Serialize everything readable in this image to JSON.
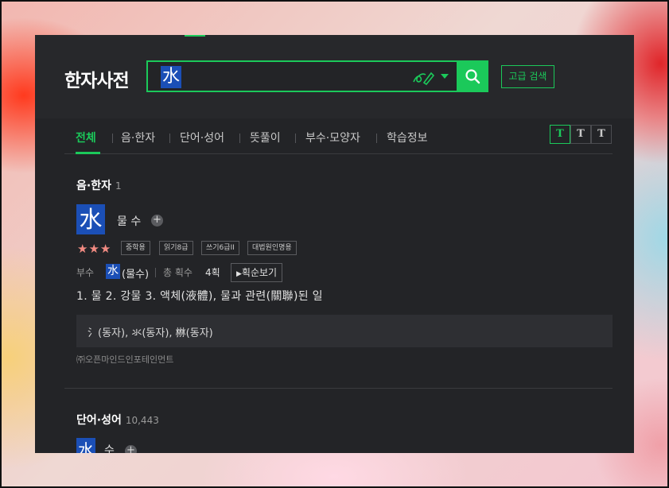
{
  "header": {
    "logo": "한자사전",
    "search_value": "水",
    "advanced_search_label": "고급 검색"
  },
  "tabs": [
    {
      "label": "전체",
      "active": true
    },
    {
      "label": "음·한자"
    },
    {
      "label": "단어·성어"
    },
    {
      "label": "뜻풀이"
    },
    {
      "label": "부수·모양자"
    },
    {
      "label": "학습정보"
    }
  ],
  "font_size_buttons": [
    "T",
    "T",
    "T"
  ],
  "sound_section": {
    "title": "음·한자",
    "count": "1",
    "hanja": "水",
    "meaning": "물 수",
    "stars": "★★★",
    "badges": [
      "중학용",
      "읽기8급",
      "쓰기6급II",
      "대법원인명용"
    ],
    "radical_label": "부수",
    "radical_hanja": "水",
    "radical_name": "(물수)",
    "stroke_label": "총 획수",
    "stroke_count": "4획",
    "stroke_button": "획순보기",
    "definitions": "1. 물  2. 강물  3. 액체(液體), 물과 관련(關聯)된 일",
    "variants": "氵(동자), 氺(동자), 㴇(동자)",
    "publisher": "㈜오픈마인드인포테인먼트"
  },
  "word_section": {
    "title": "단어·성어",
    "count": "10,443",
    "first_hanja": "水",
    "first_meaning": "수"
  },
  "colors": {
    "accent": "#1bc95a",
    "highlight": "#1b4fb6",
    "panel_bg": "#232427",
    "star": "#f28b82"
  }
}
